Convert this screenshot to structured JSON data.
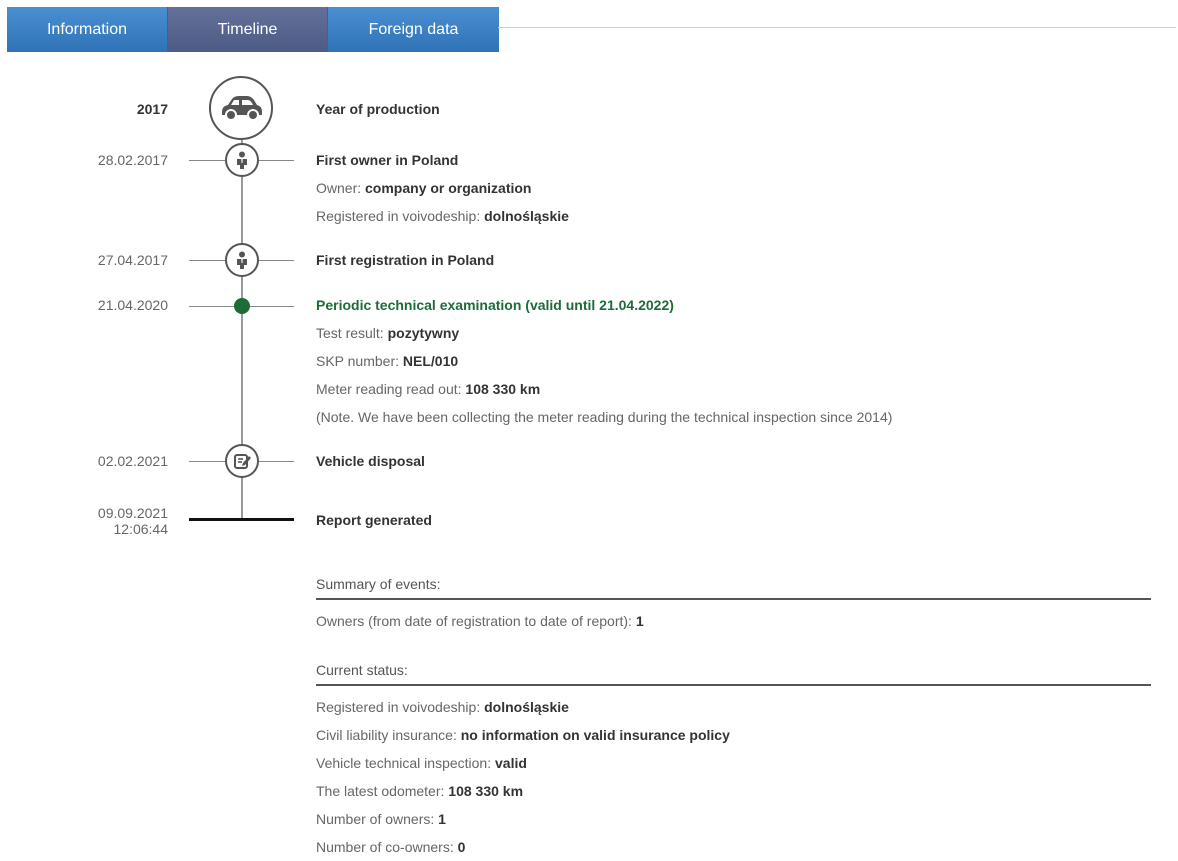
{
  "tabs": [
    {
      "label": "Information",
      "active": false
    },
    {
      "label": "Timeline",
      "active": true
    },
    {
      "label": "Foreign data",
      "active": false
    }
  ],
  "colors": {
    "tab_blue": "#3a80c4",
    "tab_active": "#56648f",
    "green_accent": "#1e6b3a"
  },
  "timeline": {
    "production": {
      "date": "2017",
      "title": "Year of production",
      "icon": "car-icon"
    },
    "first_owner": {
      "date": "28.02.2017",
      "icon": "person-icon",
      "title": "First owner in Poland",
      "owner_label": "Owner: ",
      "owner_value": "company or organization",
      "region_label": "Registered in voivodeship: ",
      "region_value": "dolnośląskie"
    },
    "first_registration": {
      "date": "27.04.2017",
      "icon": "person-icon",
      "title": "First registration in Poland"
    },
    "inspection": {
      "date": "21.04.2020",
      "title": "Periodic technical examination (valid until 21.04.2022)",
      "result_label": "Test result: ",
      "result_value": "pozytywny",
      "skp_label": "SKP number: ",
      "skp_value": "NEL/010",
      "meter_label": "Meter reading read out: ",
      "meter_value": "108 330 km",
      "note": "(Note. We have been collecting the meter reading during the technical inspection since 2014)"
    },
    "disposal": {
      "date": "02.02.2021",
      "icon": "document-edit-icon",
      "title": "Vehicle disposal"
    },
    "report": {
      "date": "09.09.2021",
      "time": "12:06:44",
      "title": "Report generated"
    }
  },
  "summary": {
    "heading": "Summary of events:",
    "owners_label": "Owners (from date of registration to date of report): ",
    "owners_value": "1"
  },
  "status": {
    "heading": "Current status:",
    "rows": [
      {
        "label": "Registered in voivodeship: ",
        "value": "dolnośląskie"
      },
      {
        "label": "Civil liability insurance: ",
        "value": "no information on valid insurance policy"
      },
      {
        "label": "Vehicle technical inspection: ",
        "value": "valid"
      },
      {
        "label": "The latest odometer: ",
        "value": "108 330 km"
      },
      {
        "label": "Number of owners: ",
        "value": "1"
      },
      {
        "label": "Number of co-owners: ",
        "value": "0"
      }
    ]
  }
}
